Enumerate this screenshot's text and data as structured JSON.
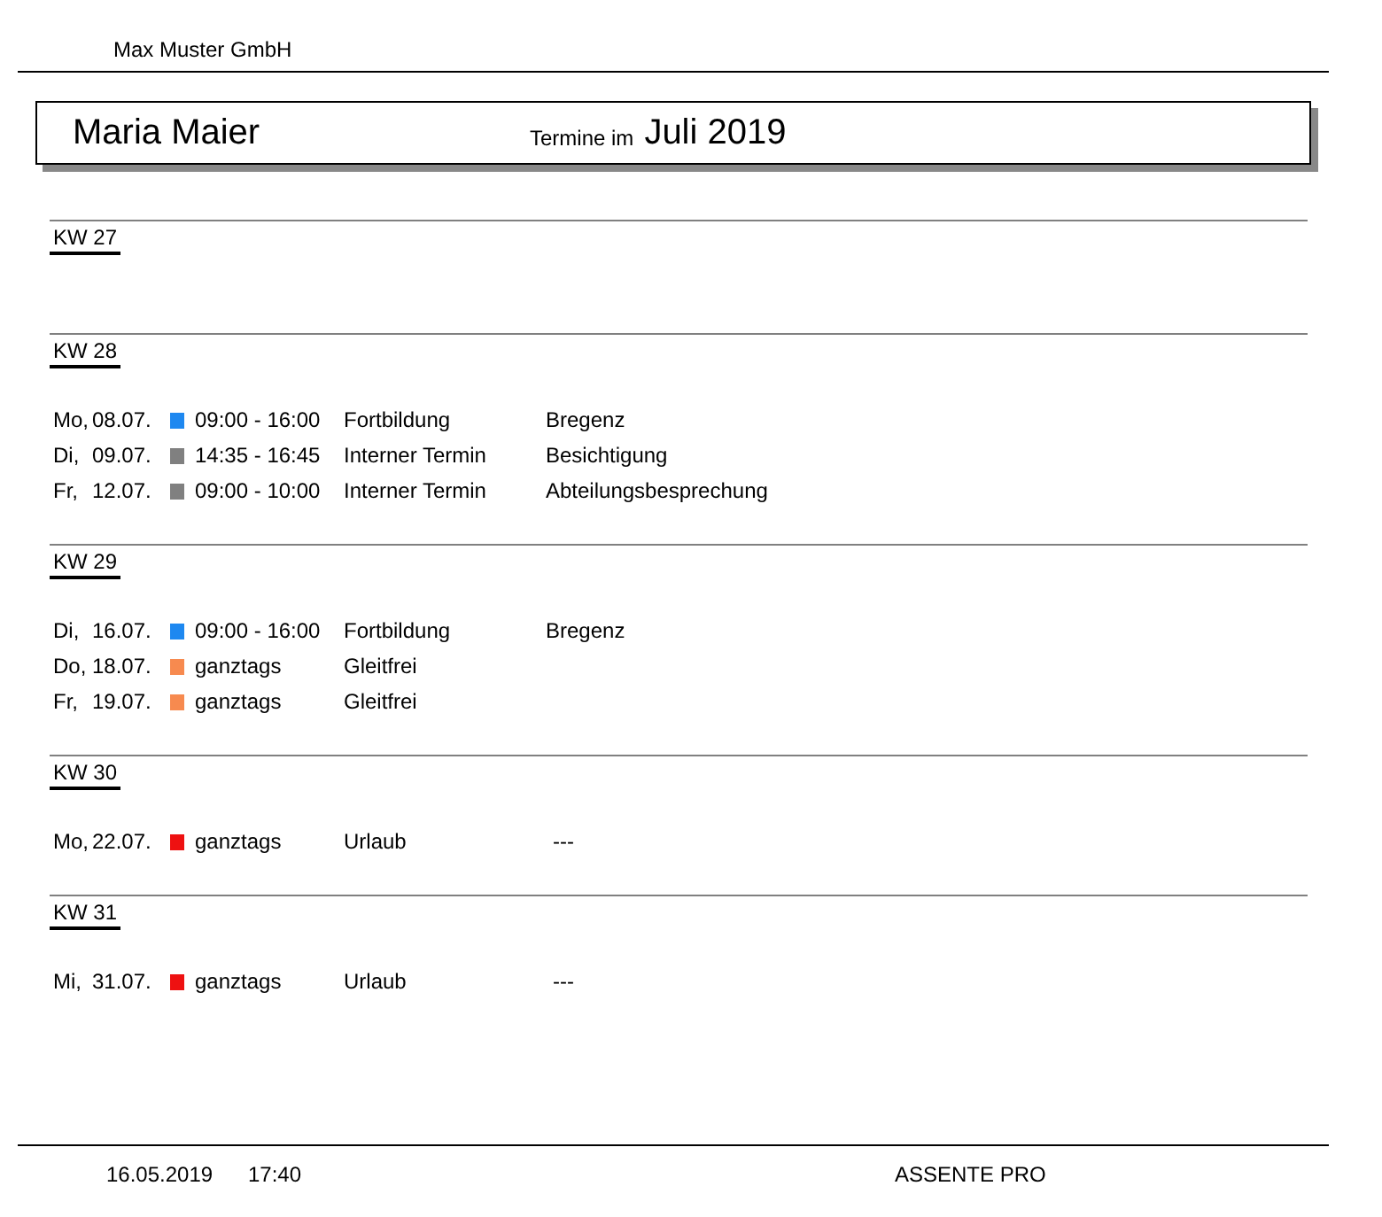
{
  "company": "Max Muster GmbH",
  "header": {
    "name": "Maria Maier",
    "label": "Termine im",
    "period": "Juli 2019"
  },
  "weeks": [
    {
      "label": "KW 27"
    },
    {
      "label": "KW 28",
      "entries": [
        {
          "day": "Mo,",
          "date": "08.07.",
          "color": "#1e88f0",
          "time": "09:00 - 16:00",
          "title": "Fortbildung",
          "detail": "Bregenz"
        },
        {
          "day": "Di,",
          "date": "09.07.",
          "color": "#808080",
          "time": "14:35 - 16:45",
          "title": "Interner Termin",
          "detail": "Besichtigung"
        },
        {
          "day": "Fr,",
          "date": "12.07.",
          "color": "#808080",
          "time": "09:00 - 10:00",
          "title": "Interner Termin",
          "detail": "Abteilungsbesprechung"
        }
      ]
    },
    {
      "label": "KW 29",
      "entries": [
        {
          "day": "Di,",
          "date": "16.07.",
          "color": "#1e88f0",
          "time": "09:00 - 16:00",
          "title": "Fortbildung",
          "detail": "Bregenz"
        },
        {
          "day": "Do,",
          "date": "18.07.",
          "color": "#f78a4f",
          "time": "ganztags",
          "title": "Gleitfrei"
        },
        {
          "day": "Fr,",
          "date": "19.07.",
          "color": "#f78a4f",
          "time": "ganztags",
          "title": "Gleitfrei"
        }
      ]
    },
    {
      "label": "KW 30",
      "entries": [
        {
          "day": "Mo,",
          "date": "22.07.",
          "color": "#ee1111",
          "time": "ganztags",
          "title": "Urlaub",
          "detail": "---"
        }
      ]
    },
    {
      "label": "KW 31",
      "entries": [
        {
          "day": "Mi,",
          "date": "31.07.",
          "color": "#ee1111",
          "time": "ganztags",
          "title": "Urlaub",
          "detail": "---"
        }
      ]
    }
  ],
  "footer": {
    "date": "16.05.2019",
    "time": "17:40",
    "product": "ASSENTE PRO"
  }
}
